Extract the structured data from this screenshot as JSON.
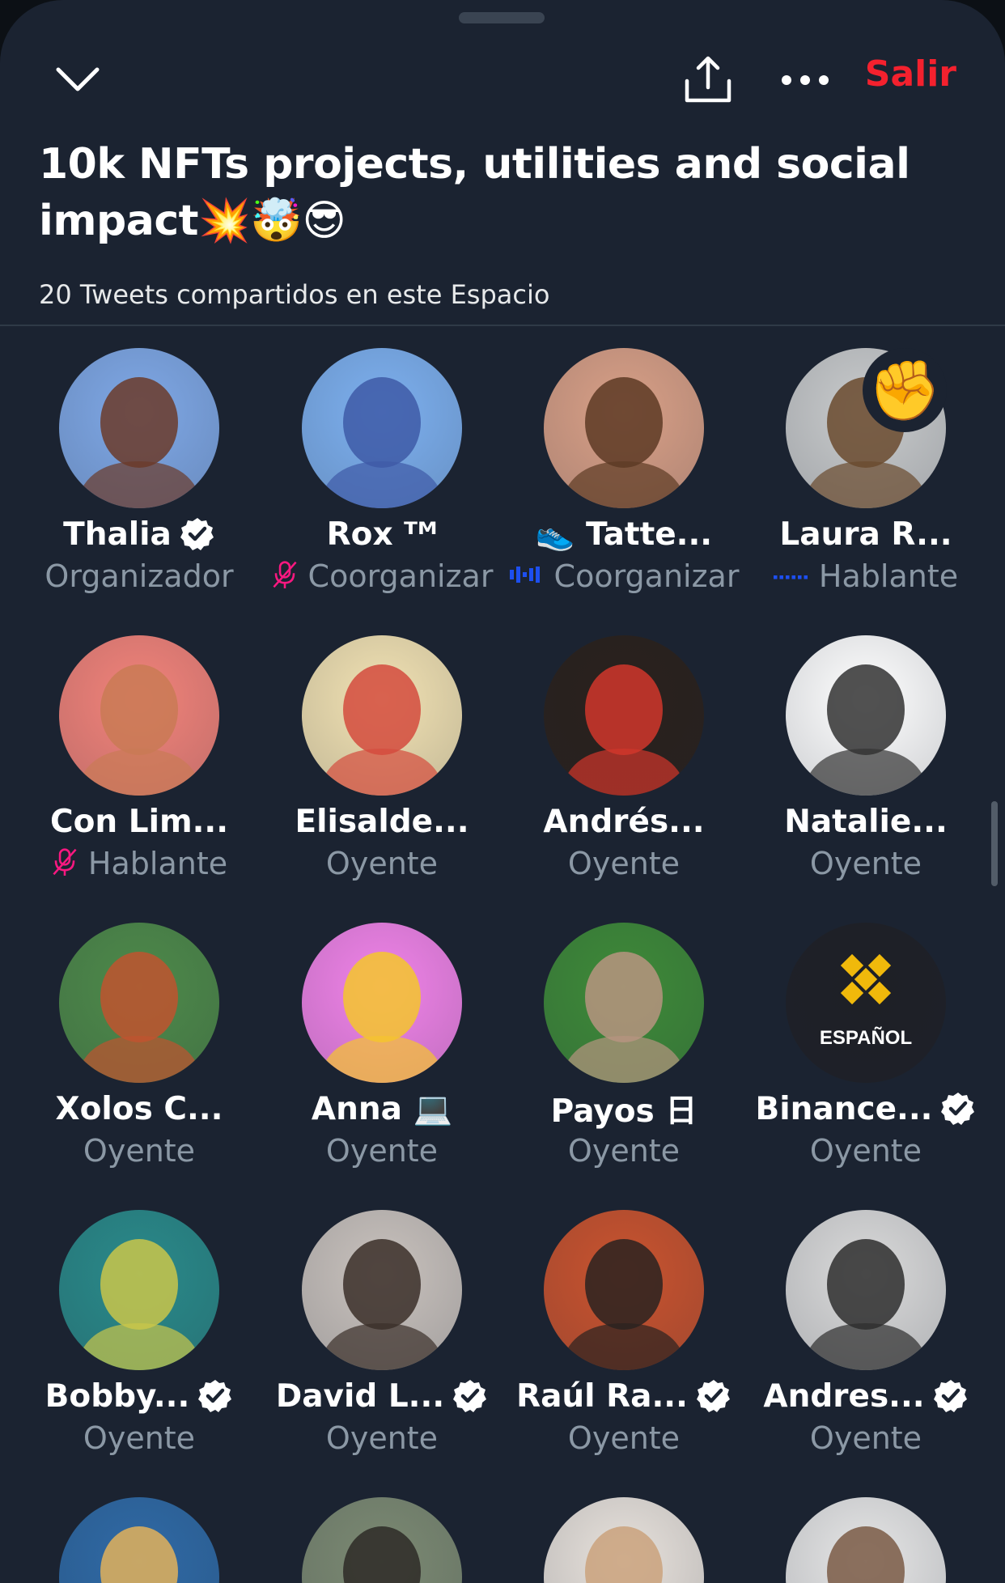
{
  "header": {
    "leave_label": "Salir",
    "title": "10k NFTs projects, utilities and social impact💥🤯😎",
    "tweets_shared": "20 Tweets compartidos en este Espacio"
  },
  "raised_hand_emoji": "✊",
  "participants": [
    {
      "name": "Thalia",
      "verified": true,
      "role": "Organizador",
      "role_icon": "none",
      "avatar_colors": [
        "#7fa8e6",
        "#6b3b2a"
      ]
    },
    {
      "name": "Rox ᵀᴹ",
      "verified": false,
      "role": "Coorganizar",
      "role_icon": "mic-off-icon",
      "avatar_colors": [
        "#7db0ef",
        "#3e5aa7"
      ]
    },
    {
      "name": "👟 Tatte...",
      "verified": false,
      "role": "Coorganizar",
      "role_icon": "speaking-wave-icon",
      "avatar_colors": [
        "#d9a087",
        "#5d3a24"
      ]
    },
    {
      "name": "Laura R...",
      "verified": false,
      "role": "Hablante",
      "role_icon": "speaking-dots-icon",
      "avatar_colors": [
        "#c9cbcc",
        "#6a4a2e"
      ]
    },
    {
      "name": "Con Lim...",
      "verified": false,
      "role": "Hablante",
      "role_icon": "mic-off-icon",
      "avatar_colors": [
        "#f2837a",
        "#c97a55"
      ]
    },
    {
      "name": "Elisalde...",
      "verified": false,
      "role": "Oyente",
      "role_icon": "none",
      "avatar_colors": [
        "#f2e2b3",
        "#d44b3d"
      ]
    },
    {
      "name": "Andrés...",
      "verified": false,
      "role": "Oyente",
      "role_icon": "none",
      "avatar_colors": [
        "#2a211c",
        "#d0362b"
      ]
    },
    {
      "name": "Natalie...",
      "verified": false,
      "role": "Oyente",
      "role_icon": "none",
      "avatar_colors": [
        "#ffffff",
        "#333333"
      ]
    },
    {
      "name": "Xolos C...",
      "verified": false,
      "role": "Oyente",
      "role_icon": "none",
      "avatar_colors": [
        "#4e8a4a",
        "#c0532f"
      ]
    },
    {
      "name": "Anna 💻",
      "verified": false,
      "role": "Oyente",
      "role_icon": "none",
      "avatar_colors": [
        "#f083e8",
        "#f5c52d"
      ]
    },
    {
      "name": "Payos 日",
      "verified": false,
      "role": "Oyente",
      "role_icon": "none",
      "avatar_colors": [
        "#3e8a39",
        "#b79480"
      ]
    },
    {
      "name": "Binance...",
      "verified": true,
      "role": "Oyente",
      "role_icon": "none",
      "avatar_colors": [
        "#1e2026",
        "#f0b90b"
      ],
      "avatar_text": "ESPAÑOL"
    },
    {
      "name": "Bobby...",
      "verified": true,
      "role": "Oyente",
      "role_icon": "none",
      "avatar_colors": [
        "#2a8a8a",
        "#c9c64a"
      ]
    },
    {
      "name": "David L...",
      "verified": true,
      "role": "Oyente",
      "role_icon": "none",
      "avatar_colors": [
        "#c9c2bd",
        "#3b2f29"
      ]
    },
    {
      "name": "Raúl Ra...",
      "verified": true,
      "role": "Oyente",
      "role_icon": "none",
      "avatar_colors": [
        "#c9532f",
        "#2a2220"
      ]
    },
    {
      "name": "Andres...",
      "verified": true,
      "role": "Oyente",
      "role_icon": "none",
      "avatar_colors": [
        "#dadada",
        "#2e2e2e"
      ]
    },
    {
      "name": "",
      "verified": false,
      "role": "",
      "role_icon": "none",
      "avatar_colors": [
        "#2f6aa6",
        "#e2b25a"
      ]
    },
    {
      "name": "",
      "verified": false,
      "role": "",
      "role_icon": "none",
      "avatar_colors": [
        "#7c8a73",
        "#2e2a27"
      ]
    },
    {
      "name": "",
      "verified": false,
      "role": "",
      "role_icon": "none",
      "avatar_colors": [
        "#e8e2dc",
        "#caa27c"
      ]
    },
    {
      "name": "",
      "verified": false,
      "role": "",
      "role_icon": "none",
      "avatar_colors": [
        "#e6e6e6",
        "#7a5a45"
      ]
    }
  ]
}
